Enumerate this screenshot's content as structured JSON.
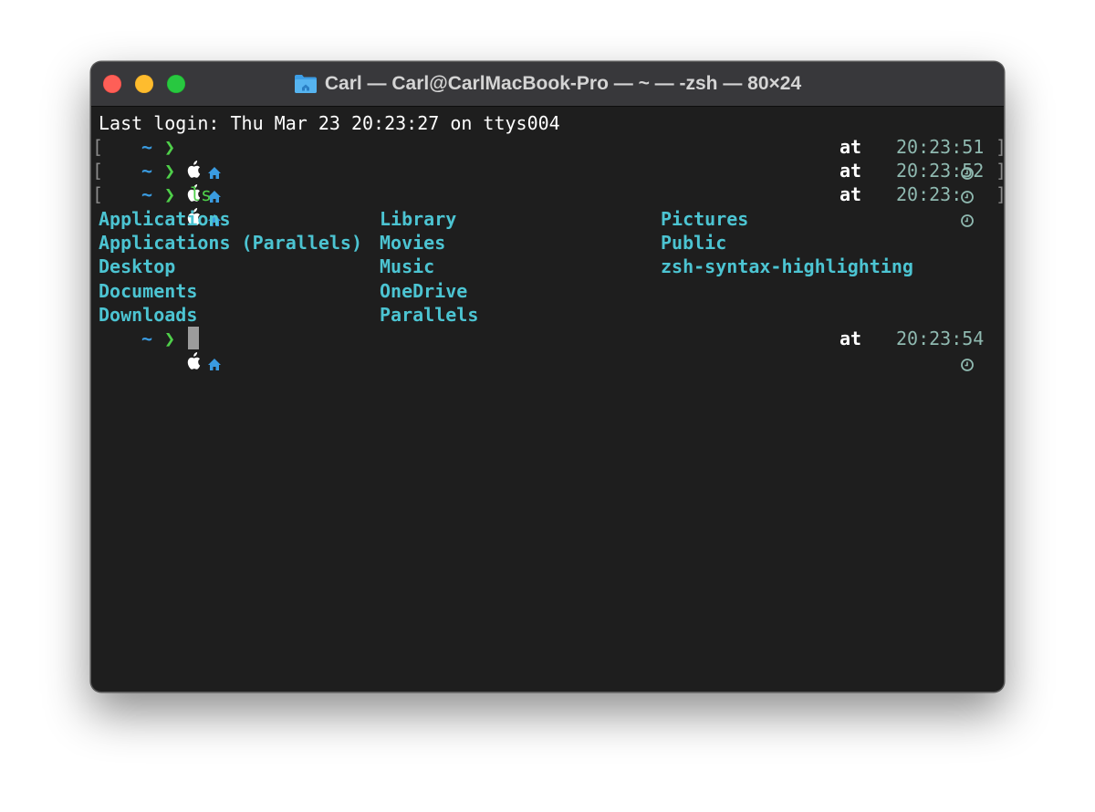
{
  "window": {
    "title": "Carl — Carl@CarlMacBook-Pro — ~ — -zsh — 80×24"
  },
  "terminal": {
    "last_login": "Last login: Thu Mar 23 20:23:27 on ttys004",
    "prompt_dir": "~",
    "prompt_arrow": "❯",
    "at_label": "at",
    "prompts": [
      {
        "command": "",
        "time": "20:23:51",
        "bracket_right": "]"
      },
      {
        "command": "",
        "time": "20:23:52",
        "bracket_right": "]"
      },
      {
        "command": "ls",
        "time": "20:23:",
        "bracket_right": "]"
      }
    ],
    "bracket_left": "[",
    "ls_output": {
      "col1": [
        "Applications",
        "Applications (Parallels)",
        "Desktop",
        "Documents",
        "Downloads"
      ],
      "col2": [
        "Library",
        "Movies",
        "Music",
        "OneDrive",
        "Parallels"
      ],
      "col3": [
        "Pictures",
        "Public",
        "zsh-syntax-highlighting"
      ]
    },
    "final_prompt": {
      "time": "20:23:54"
    }
  },
  "icons": {
    "title_folder": "home-folder-icon",
    "prompt_os": "apple-icon",
    "prompt_home": "home-icon",
    "clock": "clock-icon"
  },
  "colors": {
    "background": "#1e1e1e",
    "titlebar": "#38383b",
    "directory": "#4cc4d2",
    "home_icon": "#3a9be0",
    "arrow": "#4fd04a",
    "time": "#8fb9b0",
    "close": "#fe5f57",
    "minimize": "#febc2e",
    "zoom": "#28c840"
  }
}
